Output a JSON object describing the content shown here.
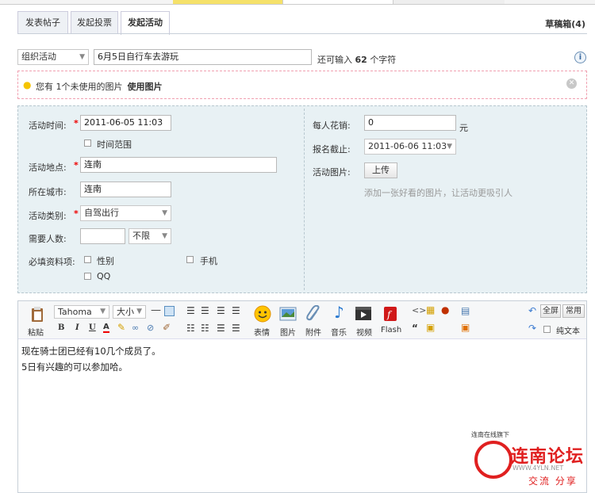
{
  "tabs": [
    "发表帖子",
    "发起投票",
    "发起活动"
  ],
  "drafts_label": "草稿箱(4)",
  "post": {
    "type_value": "组织活动",
    "title_value": "6月5日自行车去游玩",
    "hint_prefix": "还可输入",
    "hint_count": "62",
    "hint_suffix": "个字符"
  },
  "notice": {
    "text": "您有 1个未使用的图片",
    "use_label": "使用图片"
  },
  "form": {
    "time_label": "活动时间:",
    "time_value": "2011-06-05 11:03",
    "time_range_label": "时间范围",
    "place_label": "活动地点:",
    "place_value": "连南",
    "city_label": "所在城市:",
    "city_value": "连南",
    "category_label": "活动类别:",
    "category_value": "自驾出行",
    "people_label": "需要人数:",
    "people_value": "",
    "people_limit": "不限",
    "required_label": "必填资料项:",
    "opt_gender": "性别",
    "opt_phone": "手机",
    "opt_qq": "QQ",
    "cost_label": "每人花销:",
    "cost_value": "0",
    "cost_unit": "元",
    "deadline_label": "报名截止:",
    "deadline_value": "2011-06-06 11:03",
    "image_label": "活动图片:",
    "upload_label": "上传",
    "image_hint": "添加一张好看的图片，让活动更吸引人"
  },
  "toolbar": {
    "paste": "粘贴",
    "font": "Tahoma",
    "size": "大小",
    "emoji": "表情",
    "image": "图片",
    "attach": "附件",
    "music": "音乐",
    "video": "视频",
    "flash": "Flash",
    "fullscreen": "全屏",
    "common": "常用",
    "plaintext": "纯文本"
  },
  "content": {
    "line1": "现在骑士团已经有10几个成员了。",
    "line2": "5日有兴趣的可以参加哈。"
  },
  "watermark": {
    "top": "连南在线旗下",
    "brand": "连南论坛",
    "url": "WWW.4YLN.NET",
    "slogan": "交流 分享"
  },
  "colors": {
    "accent_red": "#e02020",
    "panel_bg": "#e8f1f4"
  }
}
